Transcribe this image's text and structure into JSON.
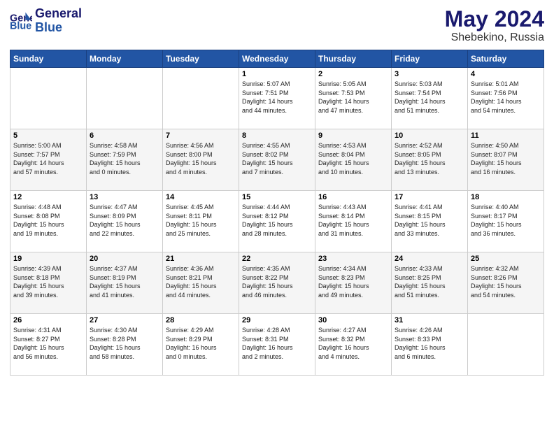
{
  "header": {
    "logo_general": "General",
    "logo_blue": "Blue",
    "month_year": "May 2024",
    "location": "Shebekino, Russia"
  },
  "days_of_week": [
    "Sunday",
    "Monday",
    "Tuesday",
    "Wednesday",
    "Thursday",
    "Friday",
    "Saturday"
  ],
  "weeks": [
    [
      {
        "day": "",
        "info": ""
      },
      {
        "day": "",
        "info": ""
      },
      {
        "day": "",
        "info": ""
      },
      {
        "day": "1",
        "info": "Sunrise: 5:07 AM\nSunset: 7:51 PM\nDaylight: 14 hours\nand 44 minutes."
      },
      {
        "day": "2",
        "info": "Sunrise: 5:05 AM\nSunset: 7:53 PM\nDaylight: 14 hours\nand 47 minutes."
      },
      {
        "day": "3",
        "info": "Sunrise: 5:03 AM\nSunset: 7:54 PM\nDaylight: 14 hours\nand 51 minutes."
      },
      {
        "day": "4",
        "info": "Sunrise: 5:01 AM\nSunset: 7:56 PM\nDaylight: 14 hours\nand 54 minutes."
      }
    ],
    [
      {
        "day": "5",
        "info": "Sunrise: 5:00 AM\nSunset: 7:57 PM\nDaylight: 14 hours\nand 57 minutes."
      },
      {
        "day": "6",
        "info": "Sunrise: 4:58 AM\nSunset: 7:59 PM\nDaylight: 15 hours\nand 0 minutes."
      },
      {
        "day": "7",
        "info": "Sunrise: 4:56 AM\nSunset: 8:00 PM\nDaylight: 15 hours\nand 4 minutes."
      },
      {
        "day": "8",
        "info": "Sunrise: 4:55 AM\nSunset: 8:02 PM\nDaylight: 15 hours\nand 7 minutes."
      },
      {
        "day": "9",
        "info": "Sunrise: 4:53 AM\nSunset: 8:04 PM\nDaylight: 15 hours\nand 10 minutes."
      },
      {
        "day": "10",
        "info": "Sunrise: 4:52 AM\nSunset: 8:05 PM\nDaylight: 15 hours\nand 13 minutes."
      },
      {
        "day": "11",
        "info": "Sunrise: 4:50 AM\nSunset: 8:07 PM\nDaylight: 15 hours\nand 16 minutes."
      }
    ],
    [
      {
        "day": "12",
        "info": "Sunrise: 4:48 AM\nSunset: 8:08 PM\nDaylight: 15 hours\nand 19 minutes."
      },
      {
        "day": "13",
        "info": "Sunrise: 4:47 AM\nSunset: 8:09 PM\nDaylight: 15 hours\nand 22 minutes."
      },
      {
        "day": "14",
        "info": "Sunrise: 4:45 AM\nSunset: 8:11 PM\nDaylight: 15 hours\nand 25 minutes."
      },
      {
        "day": "15",
        "info": "Sunrise: 4:44 AM\nSunset: 8:12 PM\nDaylight: 15 hours\nand 28 minutes."
      },
      {
        "day": "16",
        "info": "Sunrise: 4:43 AM\nSunset: 8:14 PM\nDaylight: 15 hours\nand 31 minutes."
      },
      {
        "day": "17",
        "info": "Sunrise: 4:41 AM\nSunset: 8:15 PM\nDaylight: 15 hours\nand 33 minutes."
      },
      {
        "day": "18",
        "info": "Sunrise: 4:40 AM\nSunset: 8:17 PM\nDaylight: 15 hours\nand 36 minutes."
      }
    ],
    [
      {
        "day": "19",
        "info": "Sunrise: 4:39 AM\nSunset: 8:18 PM\nDaylight: 15 hours\nand 39 minutes."
      },
      {
        "day": "20",
        "info": "Sunrise: 4:37 AM\nSunset: 8:19 PM\nDaylight: 15 hours\nand 41 minutes."
      },
      {
        "day": "21",
        "info": "Sunrise: 4:36 AM\nSunset: 8:21 PM\nDaylight: 15 hours\nand 44 minutes."
      },
      {
        "day": "22",
        "info": "Sunrise: 4:35 AM\nSunset: 8:22 PM\nDaylight: 15 hours\nand 46 minutes."
      },
      {
        "day": "23",
        "info": "Sunrise: 4:34 AM\nSunset: 8:23 PM\nDaylight: 15 hours\nand 49 minutes."
      },
      {
        "day": "24",
        "info": "Sunrise: 4:33 AM\nSunset: 8:25 PM\nDaylight: 15 hours\nand 51 minutes."
      },
      {
        "day": "25",
        "info": "Sunrise: 4:32 AM\nSunset: 8:26 PM\nDaylight: 15 hours\nand 54 minutes."
      }
    ],
    [
      {
        "day": "26",
        "info": "Sunrise: 4:31 AM\nSunset: 8:27 PM\nDaylight: 15 hours\nand 56 minutes."
      },
      {
        "day": "27",
        "info": "Sunrise: 4:30 AM\nSunset: 8:28 PM\nDaylight: 15 hours\nand 58 minutes."
      },
      {
        "day": "28",
        "info": "Sunrise: 4:29 AM\nSunset: 8:29 PM\nDaylight: 16 hours\nand 0 minutes."
      },
      {
        "day": "29",
        "info": "Sunrise: 4:28 AM\nSunset: 8:31 PM\nDaylight: 16 hours\nand 2 minutes."
      },
      {
        "day": "30",
        "info": "Sunrise: 4:27 AM\nSunset: 8:32 PM\nDaylight: 16 hours\nand 4 minutes."
      },
      {
        "day": "31",
        "info": "Sunrise: 4:26 AM\nSunset: 8:33 PM\nDaylight: 16 hours\nand 6 minutes."
      },
      {
        "day": "",
        "info": ""
      }
    ]
  ]
}
